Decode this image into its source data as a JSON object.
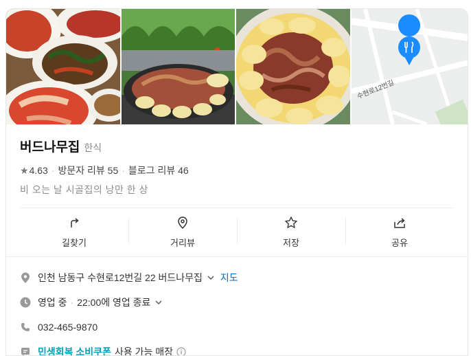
{
  "place": {
    "name": "버드나무집",
    "category": "한식",
    "rating": "4.63",
    "visitor_reviews": "방문자 리뷰 55",
    "blog_reviews": "블로그 리뷰 46",
    "tagline": "비 오는 날 시골집의 낭만 한 상"
  },
  "map": {
    "street_label": "수현로12번길"
  },
  "actions": [
    {
      "label": "길찾기",
      "icon": "directions-icon"
    },
    {
      "label": "거리뷰",
      "icon": "location-pin-icon"
    },
    {
      "label": "저장",
      "icon": "star-icon"
    },
    {
      "label": "공유",
      "icon": "share-icon"
    }
  ],
  "details": {
    "address": "인천 남동구 수현로12번길 22 버드나무집",
    "map_link": "지도",
    "hours_status": "영업 중",
    "hours_close": "22:00에 영업 종료",
    "phone": "032-465-9870",
    "coupon_label": "민생회복 소비쿠폰",
    "coupon_text": "사용 가능 매장"
  },
  "colors": {
    "link": "#0068c3",
    "coupon": "#03a0b8",
    "map_pin": "#1a8cff"
  }
}
